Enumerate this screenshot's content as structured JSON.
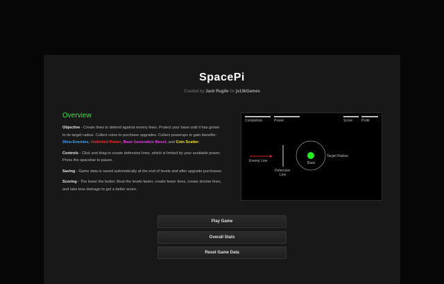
{
  "header": {
    "title": "SpacePi",
    "credit_prefix": "Created by",
    "author": "Jack Rugile",
    "credit_mid": "for",
    "event": "js13kGames"
  },
  "overview": {
    "heading": "Overview",
    "objective_label": "Objective",
    "objective_text": " - Create lines to defend against enemy lines. Protect your base until it has grown to its target radius. Collect coins to purchase upgrades. Collect powerups to gain benefits: ",
    "powerups": [
      "Slow Enemies",
      "Unlimited Power",
      "Base Generation Boost",
      "Coin Scatter"
    ],
    "sep1": ", ",
    "sep2": ", ",
    "sep3": ", and ",
    "end": ".",
    "controls_label": "Controls",
    "controls_text": " - Click and drag to create defensive lines, which is limited by your available power. Press the spacebar to pause.",
    "saving_label": "Saving",
    "saving_text": " - Game data is saved automatically at the end of levels and after upgrade purchases.",
    "scoring_label": "Scoring",
    "scoring_text": " - The lower the better. Beat the levels faster, create fewer lines, create shorter lines, and take less damage to get a better score."
  },
  "diagram": {
    "hud": [
      "Completion",
      "Power",
      "Score",
      "Profit"
    ],
    "enemy_line": "Enemy Line",
    "defensive_line": [
      "Defensive",
      "Line"
    ],
    "base": "Base",
    "target_radius": "Target Radius",
    "colors": {
      "enemy": "#e02020",
      "base": "#22ee22",
      "defense": "#dddddd"
    }
  },
  "buttons": {
    "play": "Play Game",
    "stats": "Overall Stats",
    "reset": "Reset Game Data"
  }
}
